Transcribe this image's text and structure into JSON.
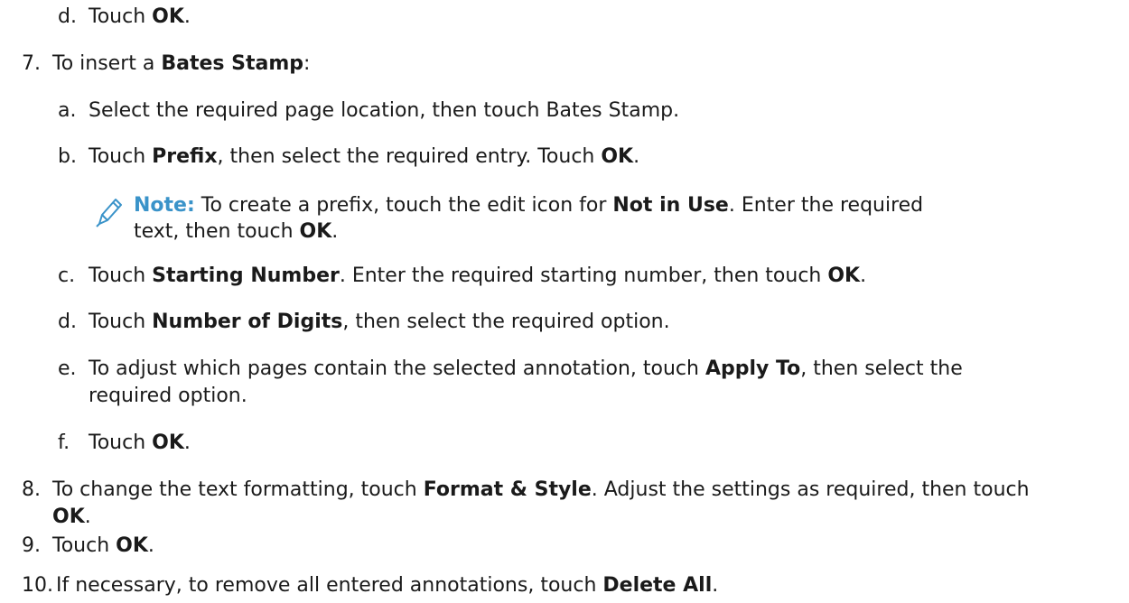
{
  "steps": {
    "d_prev": {
      "marker": "d.",
      "pre": "Touch ",
      "bold": "OK",
      "post": "."
    },
    "seven": {
      "marker": "7.",
      "pre": "To insert a ",
      "bold": "Bates Stamp",
      "post": ":"
    },
    "seven_a": {
      "marker": "a.",
      "text": "Select the required page location, then touch Bates Stamp."
    },
    "seven_b": {
      "marker": "b.",
      "pre": "Touch ",
      "bold1": "Prefix",
      "mid": ", then select the required entry. Touch ",
      "bold2": "OK",
      "post": "."
    },
    "note": {
      "label": "Note:",
      "line1_pre": " To create a prefix, touch the edit icon for ",
      "line1_bold": "Not in Use",
      "line1_post": ". Enter the required",
      "line2_pre": "text, then touch ",
      "line2_bold": "OK",
      "line2_post": ".",
      "icon": "pencil-icon"
    },
    "seven_c": {
      "marker": "c.",
      "pre": "Touch ",
      "bold1": "Starting Number",
      "mid": ". Enter the required starting number, then touch ",
      "bold2": "OK",
      "post": "."
    },
    "seven_d": {
      "marker": "d.",
      "pre": "Touch ",
      "bold": "Number of Digits",
      "post": ", then select the required option."
    },
    "seven_e": {
      "marker": "e.",
      "line1_pre": "To adjust which pages contain the selected annotation, touch ",
      "line1_bold": "Apply To",
      "line1_post": ", then select the",
      "line2": "required option."
    },
    "seven_f": {
      "marker": "f.",
      "pre": "Touch ",
      "bold": "OK",
      "post": "."
    },
    "eight": {
      "marker": "8.",
      "line1_pre": "To change the text formatting, touch ",
      "line1_bold": "Format & Style",
      "line1_post": ". Adjust the settings as required, then touch",
      "line2_bold": "OK",
      "line2_post": "."
    },
    "nine": {
      "marker": "9.",
      "pre": "Touch ",
      "bold": "OK",
      "post": "."
    },
    "ten": {
      "marker": "10.",
      "pre": "If necessary, to remove all entered annotations, touch ",
      "bold": "Delete All",
      "post": "."
    }
  },
  "colors": {
    "text": "#1a1a1a",
    "note_accent": "#3a93c9"
  }
}
